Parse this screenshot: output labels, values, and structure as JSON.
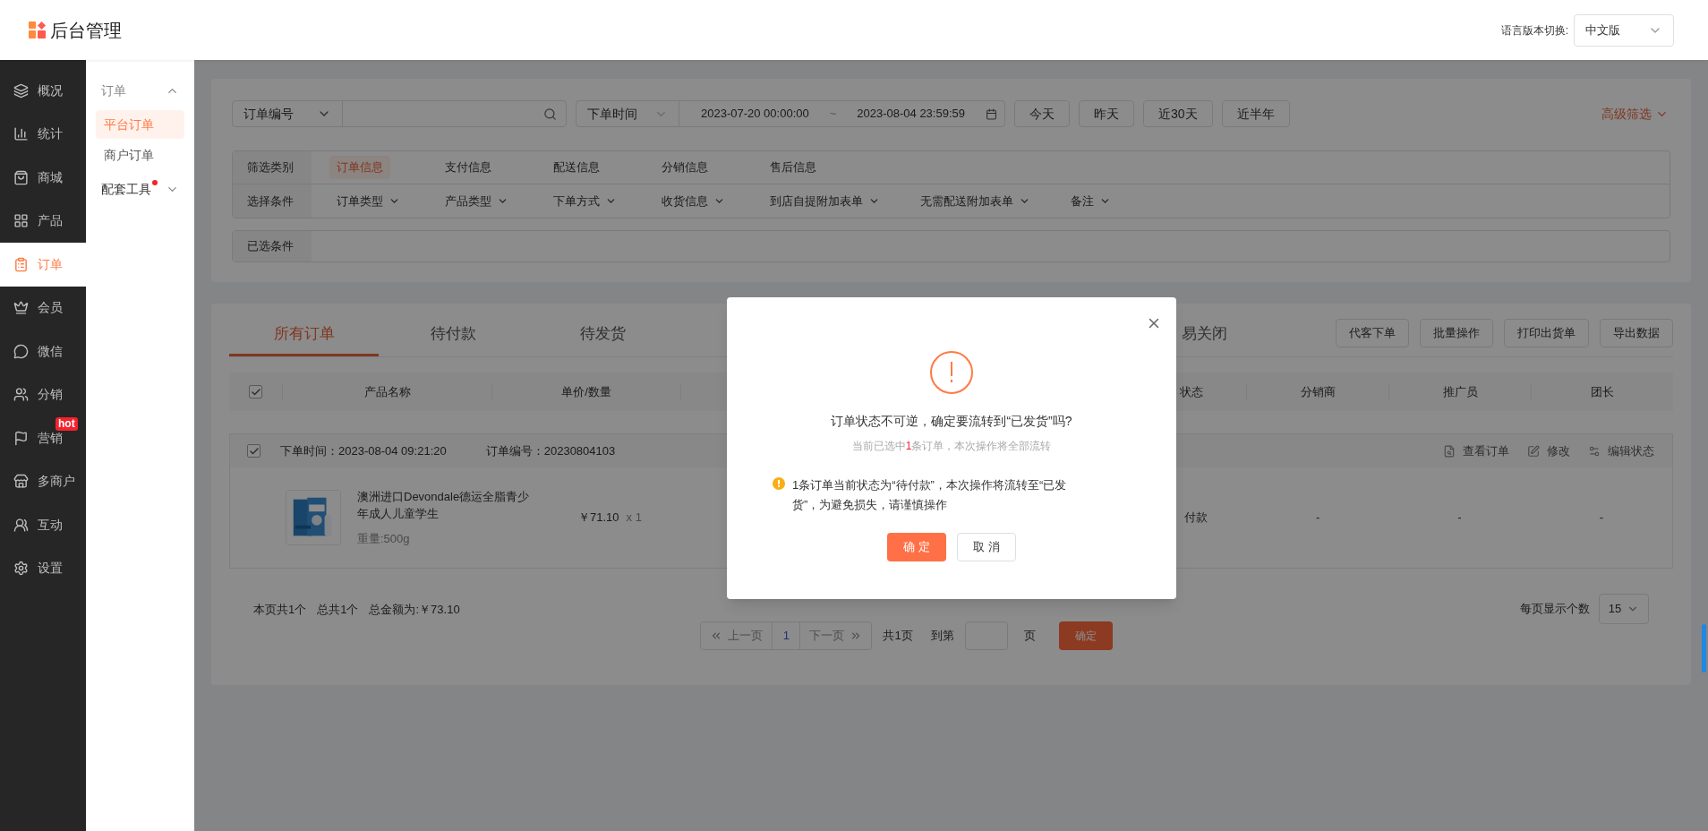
{
  "header": {
    "logo_text": "后台管理",
    "language_label": "语言版本切换:",
    "language_value": "中文版"
  },
  "nav": [
    {
      "label": "概况",
      "selected": false
    },
    {
      "label": "统计",
      "selected": false
    },
    {
      "label": "商城",
      "selected": false
    },
    {
      "label": "产品",
      "selected": false
    },
    {
      "label": "订单",
      "selected": true
    },
    {
      "label": "会员",
      "selected": false
    },
    {
      "label": "微信",
      "selected": false
    },
    {
      "label": "分销",
      "selected": false
    },
    {
      "label": "营销",
      "selected": false,
      "badge": "hot"
    },
    {
      "label": "多商户",
      "selected": false
    },
    {
      "label": "互动",
      "selected": false
    },
    {
      "label": "设置",
      "selected": false
    }
  ],
  "subnav": [
    {
      "label": "订单",
      "expanded": true,
      "notice": false,
      "children": [
        {
          "label": "平台订单",
          "selected": true
        },
        {
          "label": "商户订单",
          "selected": false
        }
      ]
    },
    {
      "label": "配套工具",
      "expanded": false,
      "notice": true
    }
  ],
  "search": {
    "field_type": "订单编号"
  },
  "date_filter": {
    "type": "下单时间",
    "start": "2023-07-20 00:00:00",
    "separator": "~",
    "end": "2023-08-04 23:59:59"
  },
  "quick_ranges": [
    "今天",
    "昨天",
    "近30天",
    "近半年"
  ],
  "advanced_filter": "高级筛选",
  "filter_categories": {
    "label": "筛选类别",
    "options": [
      {
        "label": "订单信息",
        "selected": true
      },
      {
        "label": "支付信息",
        "selected": false
      },
      {
        "label": "配送信息",
        "selected": false
      },
      {
        "label": "分销信息",
        "selected": false
      },
      {
        "label": "售后信息",
        "selected": false
      }
    ]
  },
  "filter_conditions": {
    "label": "选择条件",
    "options": [
      "订单类型",
      "产品类型",
      "下单方式",
      "收货信息",
      "到店自提附加表单",
      "无需配送附加表单",
      "备注"
    ]
  },
  "selected_conditions": {
    "label": "已选条件"
  },
  "tabs": [
    {
      "label": "所有订单",
      "selected": true
    },
    {
      "label": "待付款",
      "selected": false
    },
    {
      "label": "待发货",
      "selected": false
    },
    {
      "label": "易关闭",
      "selected": false
    }
  ],
  "toolbar": [
    "代客下单",
    "批量操作",
    "打印出货单",
    "导出数据"
  ],
  "table": {
    "all_checked": true,
    "columns": [
      "产品名称",
      "单价/数量",
      "状态",
      "分销商",
      "推广员",
      "团长"
    ]
  },
  "orders": [
    {
      "checked": true,
      "time": "下单时间：2023-08-04 09:21:20",
      "number": "订单编号：20230804103",
      "actions": [
        "查看订单",
        "修改",
        "编辑状态"
      ],
      "product": {
        "name": "澳洲进口Devondale德运全脂青少年成人儿童学生",
        "weight": "重量:500g",
        "price": "￥71.10",
        "quantity": "x 1"
      },
      "status": "付款",
      "distributor": "-",
      "promoter": "-",
      "leader": "-"
    }
  ],
  "summary": [
    "本页共1个",
    "总共1个",
    "总金额为:￥73.10"
  ],
  "pagination": {
    "prev": {
      "label": "上一页",
      "disabled": true
    },
    "pages": [
      {
        "label": "1",
        "selected": true
      }
    ],
    "next": {
      "label": "下一页",
      "disabled": true
    },
    "total": "共1页",
    "goto_label": "到第",
    "goto_suffix": "页",
    "goto_button": "确定",
    "page_size_label": "每页显示个数",
    "page_size": "15"
  },
  "dialog": {
    "title": "订单状态不可逆，确定要流转到“已发货”吗?",
    "note_before": "当前已选中",
    "note_count": "1",
    "note_after": "条订单，本次操作将全部流转",
    "warning": "1条订单当前状态为“待付款”，本次操作将流转至“已发货”，为避免损失，请谨慎操作",
    "confirm": "确 定",
    "cancel": "取 消"
  }
}
